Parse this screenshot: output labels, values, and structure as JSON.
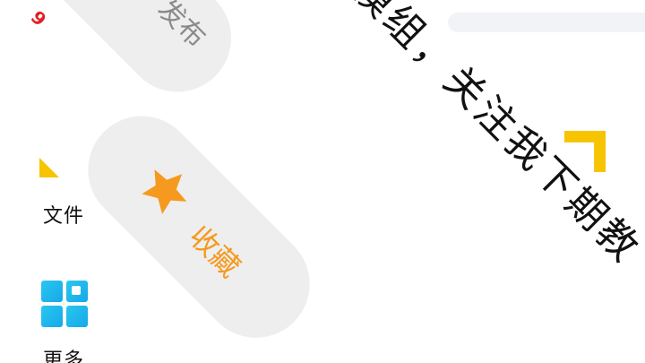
{
  "sidebar": {
    "file_label": "文件",
    "more_label": "更多"
  },
  "panel": {
    "publish_label": "发布",
    "badge_count": "9",
    "favorite_label": "收藏",
    "banner_text": "模组，关注我下期教"
  },
  "colors": {
    "accent": "#f59a1e",
    "badge_red": "#e41d25",
    "corner_yellow": "#f6c400",
    "pill_bg": "#eeeeef"
  },
  "icons": {
    "favorite": "star-icon",
    "more": "grid-icon",
    "file_corner": "triangle-corner-icon"
  }
}
